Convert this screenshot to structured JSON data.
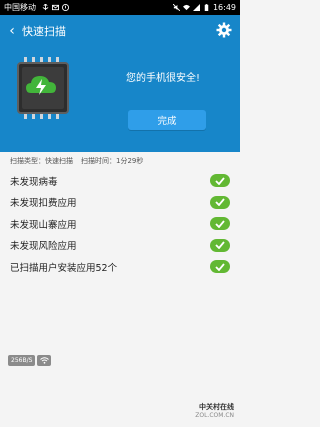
{
  "status_bar": {
    "carrier": "中国移动",
    "time": "16:49"
  },
  "appbar": {
    "title": "快速扫描"
  },
  "hero": {
    "message": "您的手机很安全!",
    "done_label": "完成"
  },
  "scan_info": {
    "type_label": "扫描类型：快速扫描",
    "time_label": "扫描时间：1分29秒"
  },
  "results": [
    {
      "label": "未发现病毒"
    },
    {
      "label": "未发现扣费应用"
    },
    {
      "label": "未发现山寨应用"
    },
    {
      "label": "未发现风险应用"
    },
    {
      "label": "已扫描用户安装应用52个"
    }
  ],
  "network": {
    "speed": "256B/S"
  },
  "watermark": {
    "line1": "中关村在线",
    "line2": "ZOL.COM.CN"
  },
  "colors": {
    "accent": "#1786c9",
    "check": "#62b833",
    "button": "#2f9ee9"
  },
  "icons": [
    "back-arrow-icon",
    "gear-icon",
    "chip-shield-icon",
    "check-icon",
    "wifi-icon"
  ]
}
